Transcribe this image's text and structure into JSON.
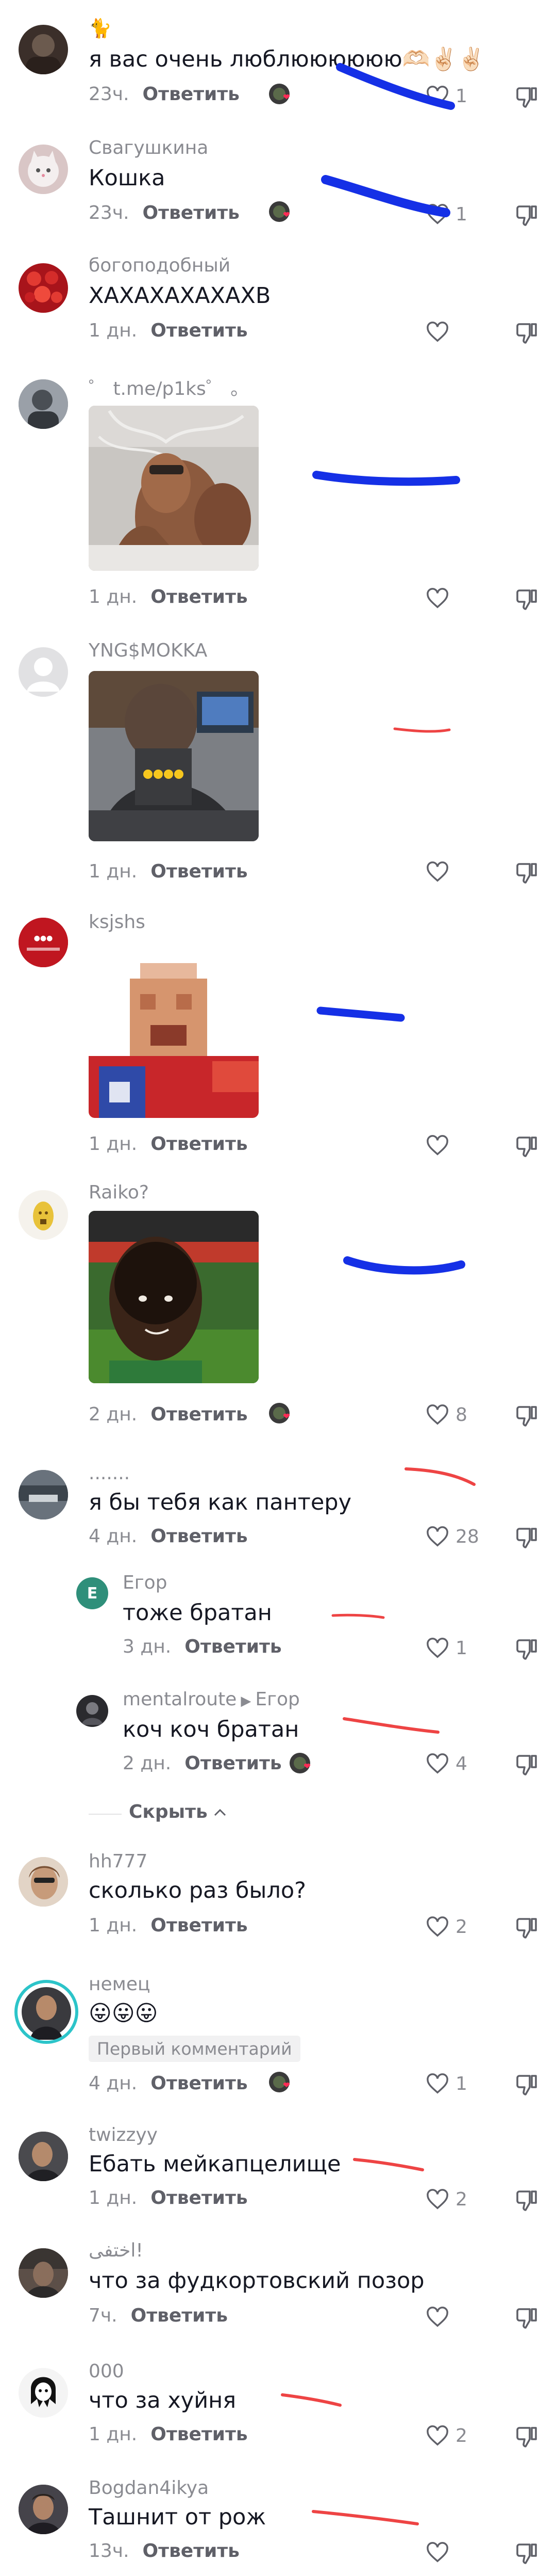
{
  "comments": [
    {
      "id": "c1",
      "username": "🐈",
      "text": "я вас очень люблюююююю🫶🏻✌🏻✌🏻",
      "time": "23ч.",
      "reply": "Ответить",
      "likes": "1"
    },
    {
      "id": "c2",
      "username": "Свагушкина",
      "text": "Кошка",
      "time": "23ч.",
      "reply": "Ответить",
      "likes": "1"
    },
    {
      "id": "c3",
      "username": "богоподобный",
      "text": "ХАХАХАХАХАХВ",
      "time": "1 дн.",
      "reply": "Ответить",
      "likes": ""
    },
    {
      "id": "c4",
      "username": "゜ t.me/p1ks゜ 。",
      "text": "",
      "time": "1 дн.",
      "reply": "Ответить",
      "likes": ""
    },
    {
      "id": "c5",
      "username": "YNG$MOKKA",
      "text": "",
      "time": "1 дн.",
      "reply": "Ответить",
      "likes": ""
    },
    {
      "id": "c6",
      "username": "ksjshs",
      "text": "",
      "time": "1 дн.",
      "reply": "Ответить",
      "likes": ""
    },
    {
      "id": "c7",
      "username": "Raiko?",
      "text": "",
      "time": "2 дн.",
      "reply": "Ответить",
      "likes": "8"
    },
    {
      "id": "c8",
      "username": ".......",
      "text": "я бы тебя как пантеру",
      "time": "4 дн.",
      "reply": "Ответить",
      "likes": "28"
    },
    {
      "id": "r1",
      "username": "Егор",
      "text": "тоже братан",
      "time": "3 дн.",
      "reply": "Ответить",
      "likes": "1"
    },
    {
      "id": "r2",
      "username": "mentalroute",
      "reply_to": "Егор",
      "text": "коч коч братан",
      "time": "2 дн.",
      "reply": "Ответить",
      "likes": "4"
    },
    {
      "id": "c9",
      "username": "hh777",
      "text": "сколько раз было?",
      "time": "1 дн.",
      "reply": "Ответить",
      "likes": "2"
    },
    {
      "id": "c10",
      "username": "немец",
      "text": "😛😛😛",
      "badge": "Первый комментарий",
      "time": "4 дн.",
      "reply": "Ответить",
      "likes": "1"
    },
    {
      "id": "c11",
      "username": "twizzyy",
      "text": "Ебать мейкапцелище",
      "time": "1 дн.",
      "reply": "Ответить",
      "likes": "2"
    },
    {
      "id": "c12",
      "username": "اختفى!",
      "text": "что за фудкортовский позор",
      "time": "7ч.",
      "reply": "Ответить",
      "likes": ""
    },
    {
      "id": "c13",
      "username": "000",
      "text": "что за хуйня",
      "time": "1 дн.",
      "reply": "Ответить",
      "likes": "2"
    },
    {
      "id": "c14",
      "username": "Bogdan4ikya",
      "text": "Ташнит от рож",
      "time": "13ч.",
      "reply": "Ответить",
      "likes": ""
    }
  ],
  "replies_toggle": "Скрыть",
  "avatar_letters": {
    "r1": "E"
  },
  "colors": {
    "scribble_blue": "#1530e6",
    "scribble_red": "#ee4444",
    "like_heart": "#fe2c55",
    "egor_avatar": "#2f8f7a"
  }
}
